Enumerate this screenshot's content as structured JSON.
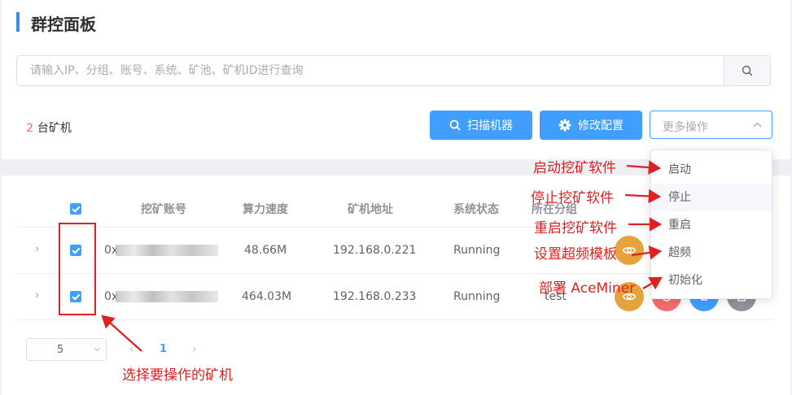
{
  "header": {
    "title": "群控面板"
  },
  "search": {
    "placeholder": "请输入IP、分组、账号、系统、矿池、矿机ID进行查询",
    "button_icon": "search-icon"
  },
  "summary": {
    "count": "2",
    "unit_label": "台矿机"
  },
  "toolbar": {
    "scan_label": "扫描机器",
    "scan_icon": "search-icon",
    "config_label": "修改配置",
    "config_icon": "gear-icon",
    "more_placeholder": "更多操作"
  },
  "more_menu": {
    "items": [
      "启动",
      "停止",
      "重启",
      "超频",
      "初始化"
    ],
    "hovered": "停止"
  },
  "table": {
    "columns": [
      "挖矿账号",
      "算力速度",
      "矿机地址",
      "系统状态",
      "所在分组"
    ],
    "rows": [
      {
        "checked": true,
        "account_prefix": "0x",
        "hashrate": "48.66M",
        "address": "192.168.0.221",
        "status": "Running",
        "group": ""
      },
      {
        "checked": true,
        "account_prefix": "0x",
        "hashrate": "464.03M",
        "address": "192.168.0.233",
        "status": "Running",
        "group": "test"
      }
    ]
  },
  "pagination": {
    "page_size": "5",
    "current_page": "1"
  },
  "annotations": {
    "start": "启动挖矿软件",
    "stop": "停止挖矿软件",
    "restart": "重启挖矿软件",
    "overclock": "设置超频模板",
    "init": "部署 AceMiner",
    "select": "选择要操作的矿机"
  },
  "colors": {
    "primary": "#409eff",
    "danger": "#f56c6c",
    "warning": "#e6a23c",
    "annotation": "#e02020"
  }
}
